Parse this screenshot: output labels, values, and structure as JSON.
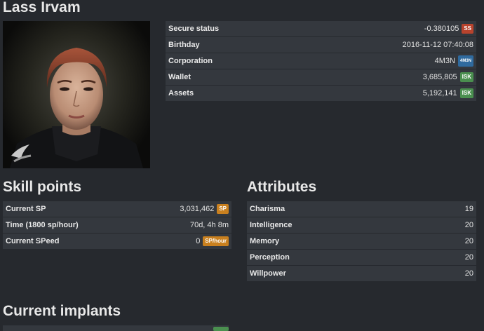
{
  "character": {
    "name": "Lass Irvam"
  },
  "info": {
    "rows": [
      {
        "label": "Secure status",
        "value": "-0.380105",
        "badge": "SS",
        "badge_color": "#b8432d"
      },
      {
        "label": "Birthday",
        "value": "2016-11-12 07:40:08",
        "badge": "",
        "badge_color": ""
      },
      {
        "label": "Corporation",
        "value": "4M3N",
        "badge": "4M3N",
        "badge_color": "#2f6a9e"
      },
      {
        "label": "Wallet",
        "value": "3,685,805",
        "badge": "ISK",
        "badge_color": "#4a8f4f"
      },
      {
        "label": "Assets",
        "value": "5,192,141",
        "badge": "ISK",
        "badge_color": "#4a8f4f"
      }
    ]
  },
  "skill_points": {
    "heading": "Skill points",
    "rows": [
      {
        "label": "Current SP",
        "value": "3,031,462",
        "badge": "SP"
      },
      {
        "label": "Time (1800 sp/hour)",
        "value": "70d, 4h 8m",
        "badge": ""
      },
      {
        "label": "Current SPeed",
        "value": "0",
        "badge": "SP/hour"
      }
    ]
  },
  "attributes": {
    "heading": "Attributes",
    "rows": [
      {
        "label": "Charisma",
        "value": "19"
      },
      {
        "label": "Intelligence",
        "value": "20"
      },
      {
        "label": "Memory",
        "value": "20"
      },
      {
        "label": "Perception",
        "value": "20"
      },
      {
        "label": "Willpower",
        "value": "20"
      }
    ]
  },
  "implants": {
    "heading": "Current implants"
  }
}
